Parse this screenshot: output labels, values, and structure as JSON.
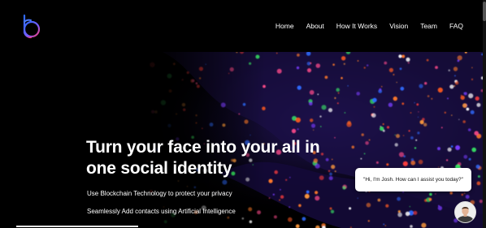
{
  "nav": {
    "items": [
      {
        "label": "Home"
      },
      {
        "label": "About"
      },
      {
        "label": "How It Works"
      },
      {
        "label": "Vision"
      },
      {
        "label": "Team"
      },
      {
        "label": "FAQ"
      }
    ]
  },
  "hero": {
    "title_line1": "Turn your face into your all in",
    "title_line2": "one social identity",
    "subtitle1": "Use Blockchain Technology to protect your privacy",
    "subtitle2": "Seamlessly Add contacts using Artificial Intelligence"
  },
  "chat": {
    "message": "\"Hi, I'm Josh. How can I assist you today?\""
  },
  "colors": {
    "background": "#000000",
    "text": "#ffffff",
    "logo_gradient_start": "#2d6bff",
    "logo_gradient_end": "#ff3a6b"
  },
  "icons": {
    "logo": "brand-logo-icon",
    "avatar": "assistant-avatar"
  }
}
